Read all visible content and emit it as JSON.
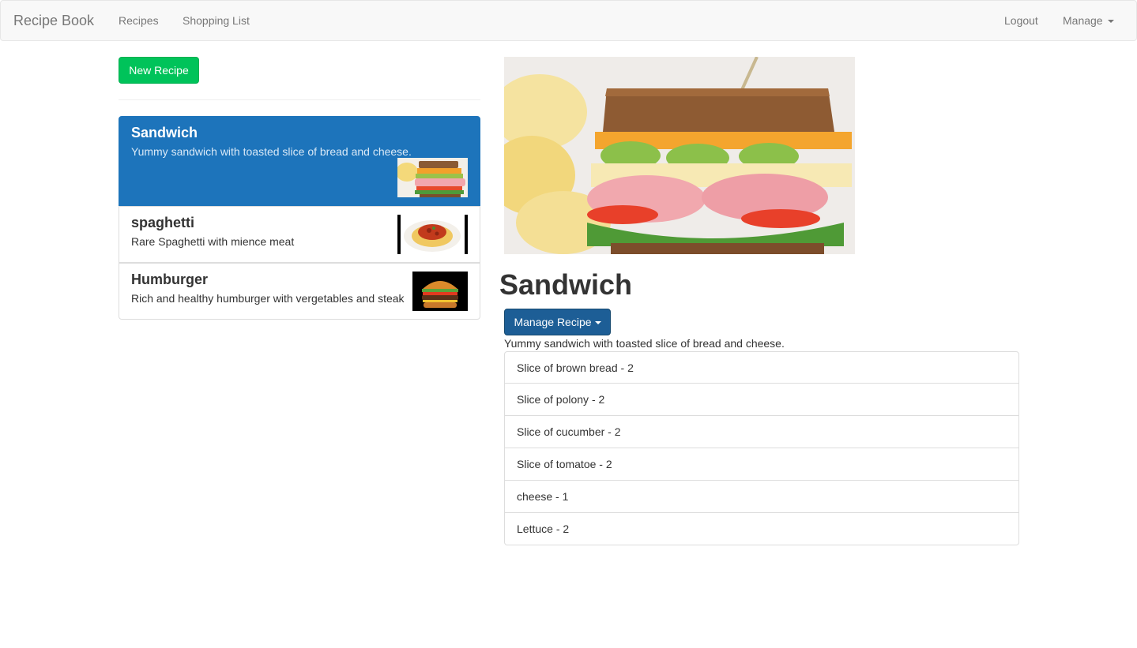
{
  "navbar": {
    "brand": "Recipe Book",
    "links": [
      "Recipes",
      "Shopping List"
    ],
    "logout": "Logout",
    "manage": "Manage"
  },
  "sidebar": {
    "new_recipe_label": "New Recipe",
    "recipes": [
      {
        "name": "Sandwich",
        "description": "Yummy sandwich with toasted slice of bread and cheese.",
        "active": true
      },
      {
        "name": "spaghetti",
        "description": "Rare Spaghetti with mience meat",
        "active": false
      },
      {
        "name": "Humburger",
        "description": "Rich and healthy humburger with vergetables and steak",
        "active": false
      }
    ]
  },
  "detail": {
    "title": "Sandwich",
    "manage_label": "Manage Recipe",
    "description": "Yummy sandwich with toasted slice of bread and cheese.",
    "ingredients": [
      "Slice of brown bread - 2",
      "Slice of polony - 2",
      "Slice of cucumber - 2",
      "Slice of tomatoe - 2",
      "cheese - 1",
      "Lettuce - 2"
    ]
  },
  "colors": {
    "active_item": "#1d74bb",
    "success_button": "#00c35a",
    "primary_button": "#1d5e96"
  }
}
